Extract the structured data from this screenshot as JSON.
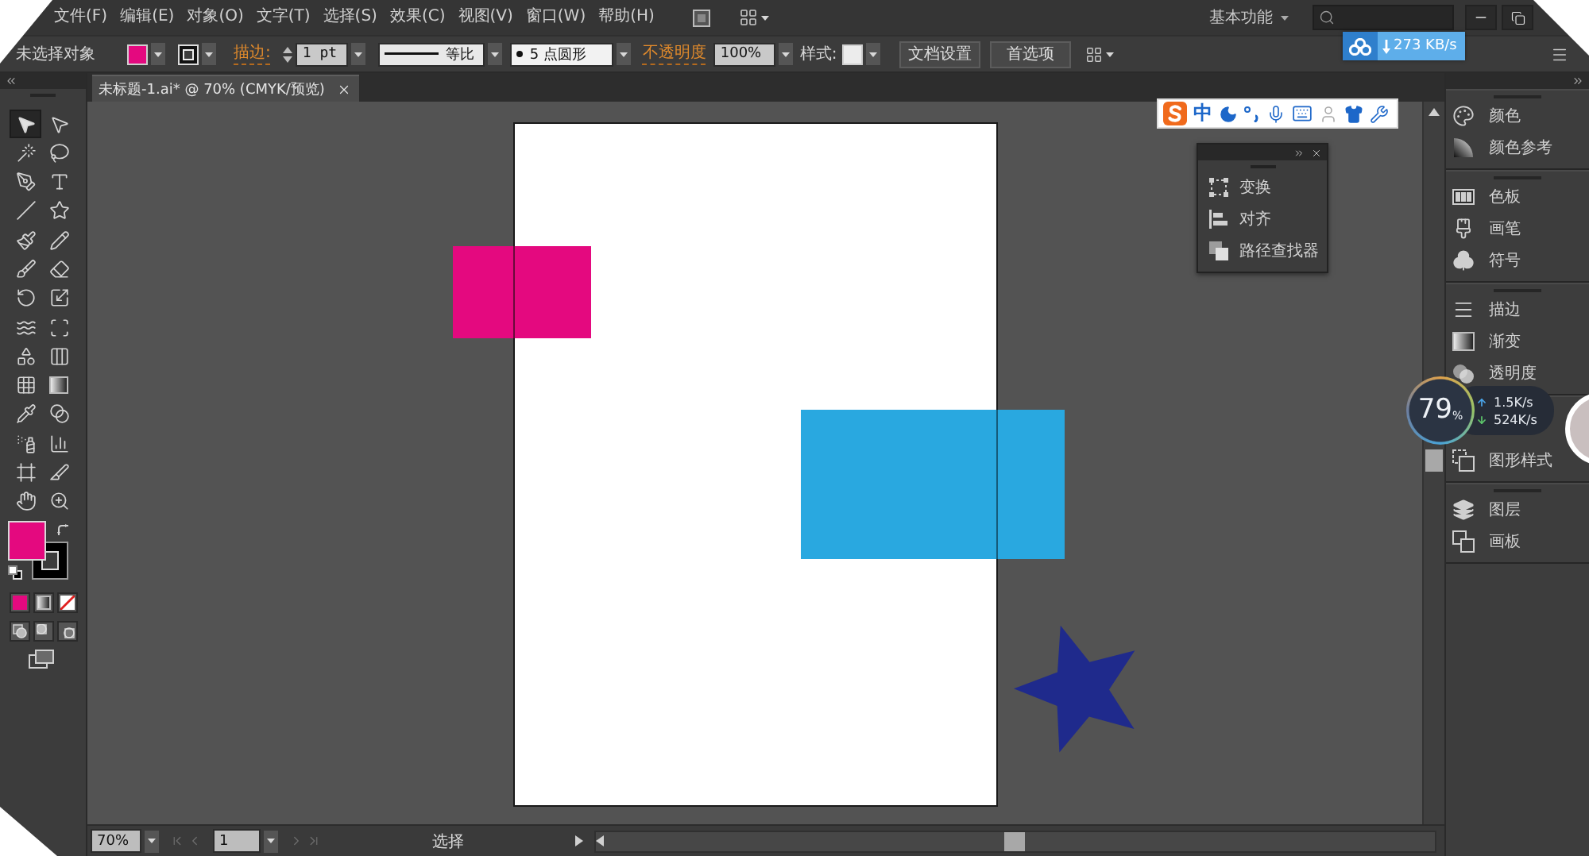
{
  "menu_bar": {
    "items": [
      "文件(F)",
      "编辑(E)",
      "对象(O)",
      "文字(T)",
      "选择(S)",
      "效果(C)",
      "视图(V)",
      "窗口(W)",
      "帮助(H)"
    ],
    "workspace": "基本功能"
  },
  "control_bar": {
    "selection": "未选择对象",
    "stroke_label": "描边:",
    "stroke_weight": "1 pt",
    "stroke_profile": "等比",
    "brush": "5 点圆形",
    "opacity_label": "不透明度",
    "opacity": "100%",
    "style_label": "样式:",
    "buttons": [
      "文档设置",
      "首选项"
    ]
  },
  "download_badge": {
    "speed": "273 KB/s"
  },
  "tabs": [
    {
      "label": "未标题-1.ai* @ 70% (CMYK/预览)",
      "selected": true
    }
  ],
  "tools": [
    {
      "kind": "selection",
      "selected": true
    },
    {
      "kind": "direct-selection",
      "selected": false
    },
    {
      "kind": "magic-wand",
      "selected": false
    },
    {
      "kind": "lasso",
      "selected": false
    },
    {
      "kind": "pen",
      "selected": false
    },
    {
      "kind": "type",
      "selected": false
    },
    {
      "kind": "line",
      "selected": false
    },
    {
      "kind": "star",
      "selected": false
    },
    {
      "kind": "paintbrush",
      "selected": false
    },
    {
      "kind": "pencil",
      "selected": false
    },
    {
      "kind": "blob-brush",
      "selected": false
    },
    {
      "kind": "eraser",
      "selected": false
    },
    {
      "kind": "rotate",
      "selected": false
    },
    {
      "kind": "scale",
      "selected": false
    },
    {
      "kind": "warp",
      "selected": false
    },
    {
      "kind": "free-transform",
      "selected": false
    },
    {
      "kind": "shape-builder",
      "selected": false
    },
    {
      "kind": "perspective-grid",
      "selected": false
    },
    {
      "kind": "mesh",
      "selected": false
    },
    {
      "kind": "gradient",
      "selected": false
    },
    {
      "kind": "eyedropper",
      "selected": false
    },
    {
      "kind": "blend",
      "selected": false
    },
    {
      "kind": "symbol-sprayer",
      "selected": false
    },
    {
      "kind": "column-graph",
      "selected": false
    },
    {
      "kind": "artboard",
      "selected": false
    },
    {
      "kind": "slice",
      "selected": false
    },
    {
      "kind": "hand",
      "selected": false
    },
    {
      "kind": "zoom",
      "selected": false
    }
  ],
  "ime_bar": {
    "mode": "中"
  },
  "floating_panel": {
    "items": [
      {
        "kind": "transform",
        "label": "变换"
      },
      {
        "kind": "align",
        "label": "对齐"
      },
      {
        "kind": "pathfinder",
        "label": "路径查找器"
      }
    ]
  },
  "panel_dock": {
    "groups": [
      {
        "items": [
          {
            "kind": "color",
            "label": "颜色"
          },
          {
            "kind": "color-guide",
            "label": "颜色参考"
          }
        ]
      },
      {
        "items": [
          {
            "kind": "swatches",
            "label": "色板"
          },
          {
            "kind": "brushes",
            "label": "画笔"
          },
          {
            "kind": "symbols",
            "label": "符号"
          }
        ]
      },
      {
        "items": [
          {
            "kind": "stroke",
            "label": "描边"
          },
          {
            "kind": "gradient",
            "label": "渐变"
          },
          {
            "kind": "transparency",
            "label": "透明度"
          }
        ]
      },
      {
        "items": [
          {
            "kind": "graphic-styles",
            "label": "图形样式"
          }
        ]
      },
      {
        "items": [
          {
            "kind": "layers",
            "label": "图层"
          },
          {
            "kind": "artboards",
            "label": "画板"
          }
        ]
      }
    ]
  },
  "speed_ball": {
    "percent": "79",
    "unit": "%",
    "upload": "1.5K/s",
    "download": "524K/s"
  },
  "status_bar": {
    "zoom": "70%",
    "page": "1",
    "nav_disabled": true,
    "tool": "选择"
  }
}
